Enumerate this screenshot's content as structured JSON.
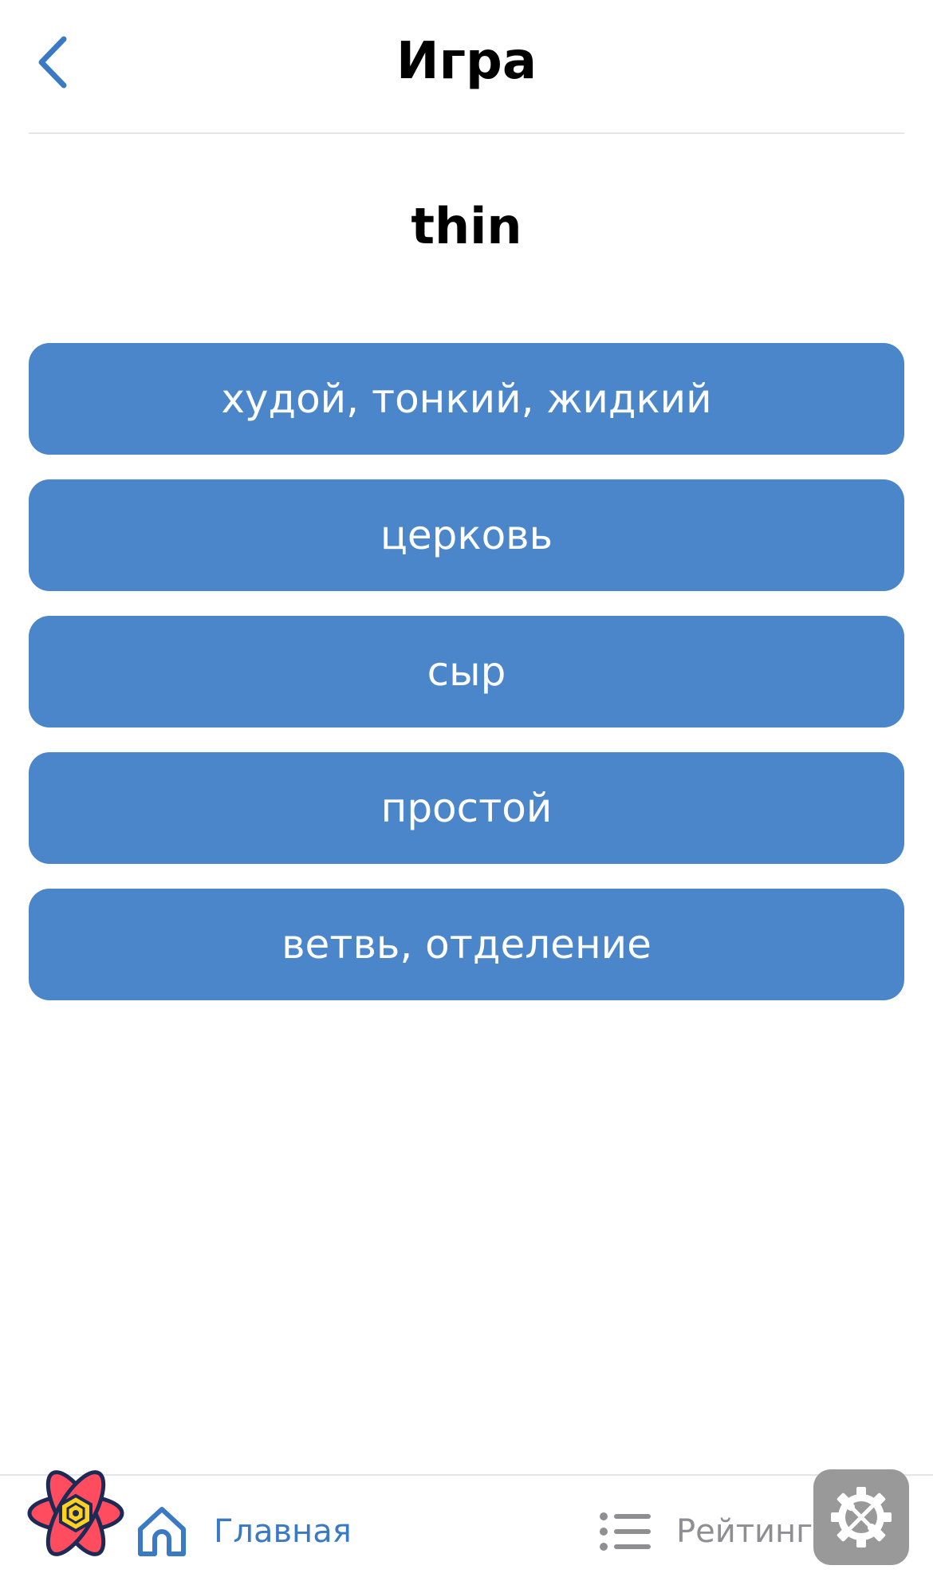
{
  "header": {
    "title": "Игра",
    "back_icon": "chevron-left-icon"
  },
  "question": {
    "word": "thin"
  },
  "answers": [
    {
      "label": "худой, тонкий, жидкий"
    },
    {
      "label": "церковь"
    },
    {
      "label": "сыр"
    },
    {
      "label": "простой"
    },
    {
      "label": "ветвь, отделение"
    }
  ],
  "tabbar": {
    "home": {
      "label": "Главная",
      "icon": "home-icon",
      "active": true
    },
    "rating": {
      "label": "Рейтинг",
      "icon": "list-icon",
      "active": false
    }
  },
  "overlay": {
    "logo_icon": "react-atom-icon",
    "settings_icon": "gear-tools-icon"
  },
  "colors": {
    "accent": "#3a79c4",
    "button": "#4a86c9",
    "inactive": "#8e8e93",
    "settings_bg": "#999999"
  }
}
